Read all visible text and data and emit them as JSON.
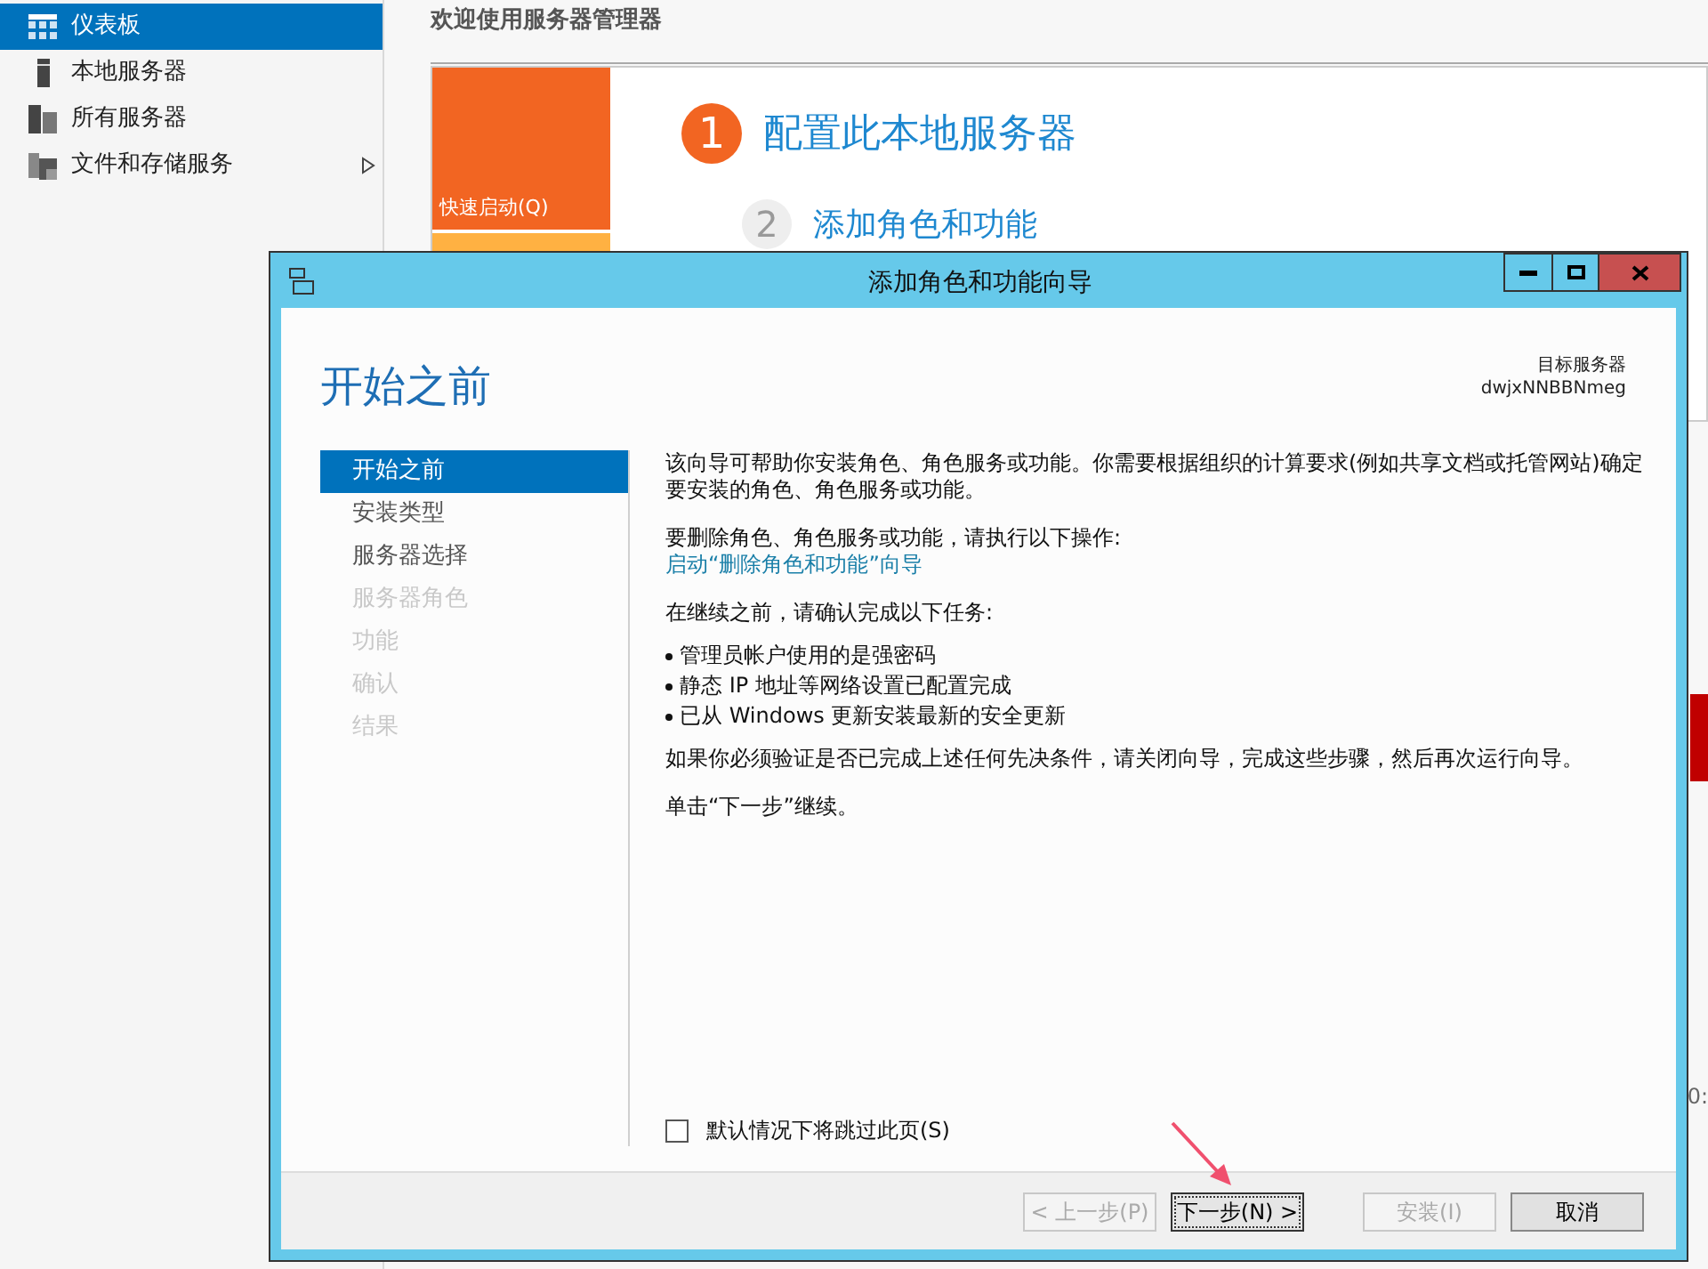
{
  "sidebar": {
    "items": [
      {
        "label": "仪表板",
        "kind": "grid",
        "selected": true,
        "expandable": false
      },
      {
        "label": "本地服务器",
        "kind": "server",
        "selected": false,
        "expandable": false
      },
      {
        "label": "所有服务器",
        "kind": "servers",
        "selected": false,
        "expandable": false
      },
      {
        "label": "文件和存储服务",
        "kind": "folders",
        "selected": false,
        "expandable": true
      }
    ]
  },
  "header": {
    "title": "欢迎使用服务器管理器"
  },
  "quick_start": {
    "label": "快速启动(Q)",
    "steps": [
      {
        "number": "1",
        "label": "配置此本地服务器",
        "active": true
      },
      {
        "number": "2",
        "label": "添加角色和功能",
        "active": false
      }
    ]
  },
  "edge_text": "0:",
  "dialog": {
    "title": "添加角色和功能向导",
    "heading": "开始之前",
    "target_label": "目标服务器",
    "target_value": "dwjxNNBBNmeg",
    "steps": [
      {
        "label": "开始之前",
        "selected": true,
        "disabled": false
      },
      {
        "label": "安装类型",
        "selected": false,
        "disabled": false
      },
      {
        "label": "服务器选择",
        "selected": false,
        "disabled": false
      },
      {
        "label": "服务器角色",
        "selected": false,
        "disabled": true
      },
      {
        "label": "功能",
        "selected": false,
        "disabled": true
      },
      {
        "label": "确认",
        "selected": false,
        "disabled": true
      },
      {
        "label": "结果",
        "selected": false,
        "disabled": true
      }
    ],
    "content": [
      {
        "kind": "paragraph",
        "text": "该向导可帮助你安装角色、角色服务或功能。你需要根据组织的计算要求(例如共享文档或托管网站)确定要安装的角色、角色服务或功能。"
      },
      {
        "kind": "paragraph",
        "text": "要删除角色、角色服务或功能，请执行以下操作:",
        "link": "启动“删除角色和功能”向导"
      },
      {
        "kind": "paragraph",
        "text": "在继续之前，请确认完成以下任务:"
      },
      {
        "kind": "bullets",
        "items": [
          "管理员帐户使用的是强密码",
          "静态 IP 地址等网络设置已配置完成",
          "已从 Windows 更新安装最新的安全更新"
        ]
      },
      {
        "kind": "paragraph",
        "text": "如果你必须验证是否已完成上述任何先决条件，请关闭向导，完成这些步骤，然后再次运行向导。"
      },
      {
        "kind": "paragraph",
        "text": "单击“下一步”继续。"
      }
    ],
    "skip_checkbox": {
      "label": "默认情况下将跳过此页(S)",
      "checked": false
    },
    "buttons": [
      {
        "label": "< 上一步(P)",
        "disabled": true,
        "focused": false,
        "kind": "nav"
      },
      {
        "label": "下一步(N) >",
        "disabled": false,
        "focused": true,
        "kind": "nav"
      },
      {
        "label": "安装(I)",
        "disabled": true,
        "focused": false,
        "kind": "action"
      },
      {
        "label": "取消",
        "disabled": false,
        "focused": false,
        "kind": "action"
      }
    ]
  }
}
